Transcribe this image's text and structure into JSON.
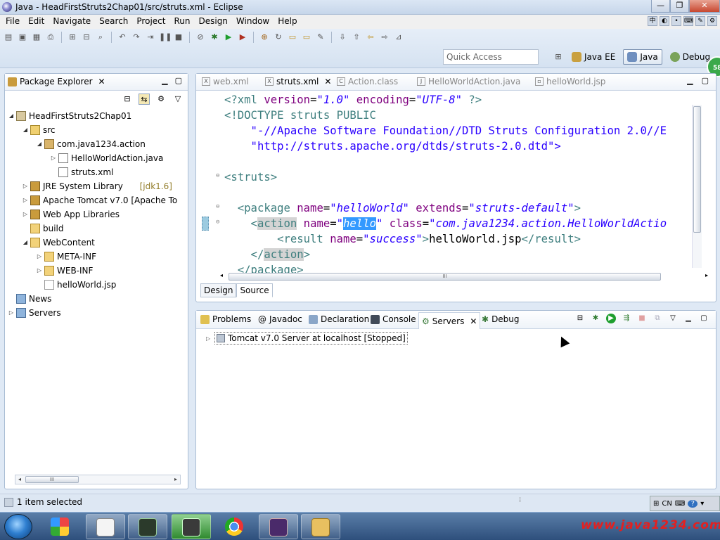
{
  "window": {
    "title": "Java - HeadFirstStruts2Chap01/src/struts.xml - Eclipse"
  },
  "menu": [
    "File",
    "Edit",
    "Navigate",
    "Search",
    "Project",
    "Run",
    "Design",
    "Window",
    "Help"
  ],
  "toolbar": {
    "quick_access_placeholder": "Quick Access"
  },
  "perspectives": [
    {
      "label": "Java EE",
      "active": false
    },
    {
      "label": "Java",
      "active": true
    },
    {
      "label": "Debug",
      "active": false
    }
  ],
  "badge": "58",
  "package_explorer": {
    "title": "Package Explorer",
    "tree": [
      {
        "label": "HeadFirstStruts2Chap01",
        "depth": 0,
        "twisty": "open",
        "icon": "project-icon"
      },
      {
        "label": "src",
        "depth": 1,
        "twisty": "open",
        "icon": "source-folder-icon"
      },
      {
        "label": "com.java1234.action",
        "depth": 2,
        "twisty": "open",
        "icon": "package-icon"
      },
      {
        "label": "HelloWorldAction.java",
        "depth": 3,
        "twisty": "closed",
        "icon": "java-file-icon"
      },
      {
        "label": "struts.xml",
        "depth": 3,
        "twisty": "none",
        "icon": "xml-file-icon"
      },
      {
        "label": "JRE System Library",
        "decor": "[jdk1.6]",
        "depth": 1,
        "twisty": "closed",
        "icon": "library-icon"
      },
      {
        "label": "Apache Tomcat v7.0 [Apache To",
        "depth": 1,
        "twisty": "closed",
        "icon": "library-icon"
      },
      {
        "label": "Web App Libraries",
        "depth": 1,
        "twisty": "closed",
        "icon": "library-icon"
      },
      {
        "label": "build",
        "depth": 1,
        "twisty": "none",
        "icon": "folder-icon"
      },
      {
        "label": "WebContent",
        "depth": 1,
        "twisty": "open",
        "icon": "folder-icon"
      },
      {
        "label": "META-INF",
        "depth": 2,
        "twisty": "closed",
        "icon": "folder-icon"
      },
      {
        "label": "WEB-INF",
        "depth": 2,
        "twisty": "closed",
        "icon": "folder-icon"
      },
      {
        "label": "helloWorld.jsp",
        "depth": 2,
        "twisty": "none",
        "icon": "jsp-file-icon"
      },
      {
        "label": "News",
        "depth": 0,
        "twisty": "none",
        "icon": "project-folder-icon"
      },
      {
        "label": "Servers",
        "depth": 0,
        "twisty": "closed",
        "icon": "project-folder-icon"
      }
    ]
  },
  "editor": {
    "tabs": [
      {
        "label": "web.xml",
        "active": false
      },
      {
        "label": "struts.xml",
        "active": true
      },
      {
        "label": "Action.class",
        "active": false
      },
      {
        "label": "HelloWorldAction.java",
        "active": false
      },
      {
        "label": "helloWorld.jsp",
        "active": false
      }
    ],
    "code": {
      "l1_pi": "<?xml ",
      "l1_a1": "version",
      "l1_v1": "\"1.0\"",
      "l1_a2": " encoding",
      "l1_v2": "\"UTF-8\"",
      "l1_end": " ?>",
      "l2": "<!DOCTYPE struts PUBLIC",
      "l3": "    \"-//Apache Software Foundation//DTD Struts Configuration 2.0//E",
      "l4": "    \"http://struts.apache.org/dtds/struts-2.0.dtd\">",
      "l6": "<struts>",
      "l8_open": "  <package",
      "l8_a1": " name",
      "l8_v1": "\"helloWorld\"",
      "l8_a2": " extends",
      "l8_v2": "\"struts-default\"",
      "l8_end": ">",
      "l9_open": "    <",
      "l9_tag": "action",
      "l9_a1": " name",
      "l9_q1": "\"",
      "l9_sel": "hello",
      "l9_q2": "\"",
      "l9_a2": " class",
      "l9_v2": "\"com.java1234.action.HelloWorldActio",
      "l10_open": "        <result",
      "l10_a1": " name",
      "l10_v1": "\"success\"",
      "l10_end": ">",
      "l10_txt": "helloWorld.jsp",
      "l10_close": "</result>",
      "l11_open": "    </",
      "l11_tag": "action",
      "l11_end": ">",
      "l12": "  </package>"
    },
    "design_tab": "Design",
    "source_tab": "Source"
  },
  "views": {
    "tabs": [
      "Problems",
      "Javadoc",
      "Declaration",
      "Console",
      "Servers",
      "Debug"
    ],
    "active": "Servers",
    "server_item": "Tomcat v7.0 Server at localhost  [Stopped]"
  },
  "status": {
    "text": "1 item selected",
    "ime": "CN"
  },
  "taskbar": {
    "brand": "www.java1234.com"
  }
}
